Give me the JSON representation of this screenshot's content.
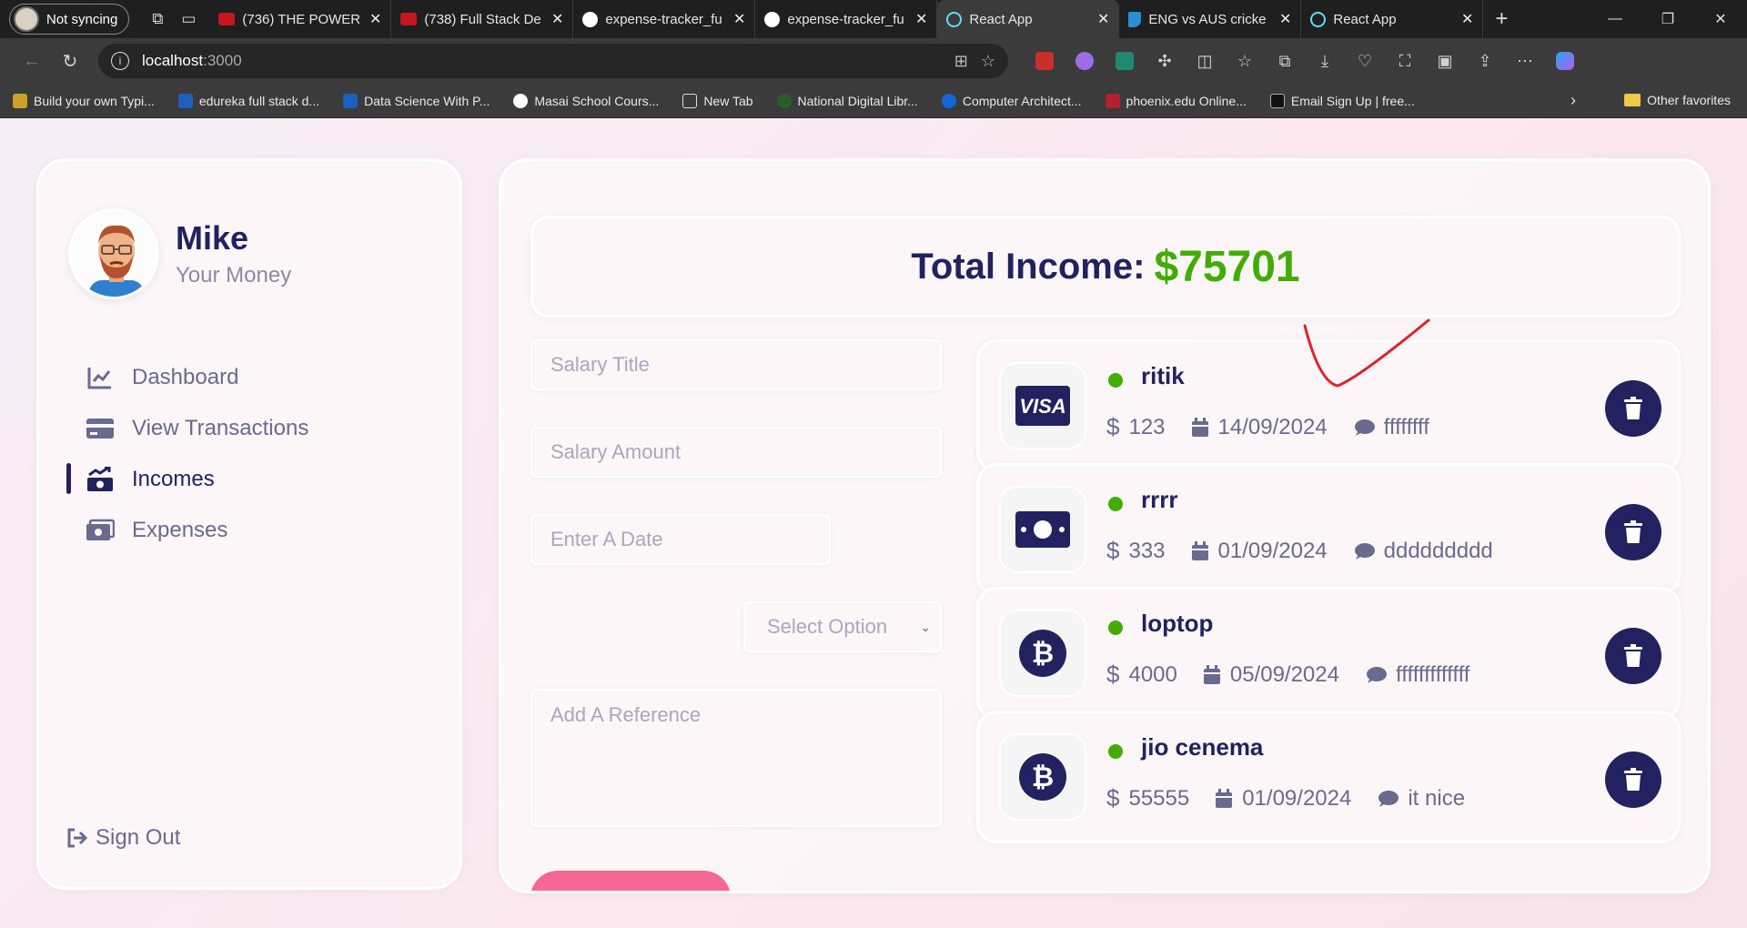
{
  "browser": {
    "profile_label": "Not syncing",
    "tabs": [
      {
        "title": "(736) THE POWER",
        "favicon": "youtube",
        "active": false
      },
      {
        "title": "(738) Full Stack De",
        "favicon": "youtube",
        "active": false
      },
      {
        "title": "expense-tracker_fu",
        "favicon": "github",
        "active": false
      },
      {
        "title": "expense-tracker_fu",
        "favicon": "github",
        "active": false
      },
      {
        "title": "React App",
        "favicon": "react",
        "active": true
      },
      {
        "title": "ENG vs AUS cricke",
        "favicon": "bing",
        "active": false
      },
      {
        "title": "React App",
        "favicon": "react",
        "active": false
      }
    ],
    "url_host": "localhost",
    "url_port": ":3000",
    "favorites": [
      {
        "label": "Build your own Typi..."
      },
      {
        "label": "edureka full stack d..."
      },
      {
        "label": "Data Science With P..."
      },
      {
        "label": "Masai School Cours..."
      },
      {
        "label": "New Tab"
      },
      {
        "label": "National Digital Libr..."
      },
      {
        "label": "Computer Architect..."
      },
      {
        "label": "phoenix.edu Online..."
      },
      {
        "label": "Email Sign Up | free..."
      }
    ],
    "other_favorites": "Other favorites"
  },
  "sidebar": {
    "user_name": "Mike",
    "user_subtitle": "Your Money",
    "menu": [
      {
        "label": "Dashboard",
        "icon": "chart-line-icon",
        "active": false
      },
      {
        "label": "View Transactions",
        "icon": "credit-card-icon",
        "active": false
      },
      {
        "label": "Incomes",
        "icon": "money-trend-up-icon",
        "active": true
      },
      {
        "label": "Expenses",
        "icon": "money-bill-icon",
        "active": false
      }
    ],
    "signout_label": "Sign Out"
  },
  "main": {
    "total_label": "Total Income:",
    "total_value": "$75701",
    "form": {
      "title_placeholder": "Salary Title",
      "amount_placeholder": "Salary Amount",
      "date_placeholder": "Enter A Date",
      "select_placeholder": "Select Option",
      "reference_placeholder": "Add A Reference"
    },
    "incomes": [
      {
        "title": "ritik",
        "amount": "123",
        "date": "14/09/2024",
        "description": "ffffffff",
        "icon": "visa-icon"
      },
      {
        "title": "rrrr",
        "amount": "333",
        "date": "01/09/2024",
        "description": "ddddddddd",
        "icon": "money-icon"
      },
      {
        "title": "loptop",
        "amount": "4000",
        "date": "05/09/2024",
        "description": "fffffffffffff",
        "icon": "bitcoin-icon"
      },
      {
        "title": "jio cenema",
        "amount": "55555",
        "date": "01/09/2024",
        "description": "it nice",
        "icon": "bitcoin-icon"
      }
    ]
  },
  "colors": {
    "primary": "#222260",
    "accent_green": "#42ad00",
    "accent_pink": "#f56692",
    "scribble_red": "#e0202a"
  }
}
